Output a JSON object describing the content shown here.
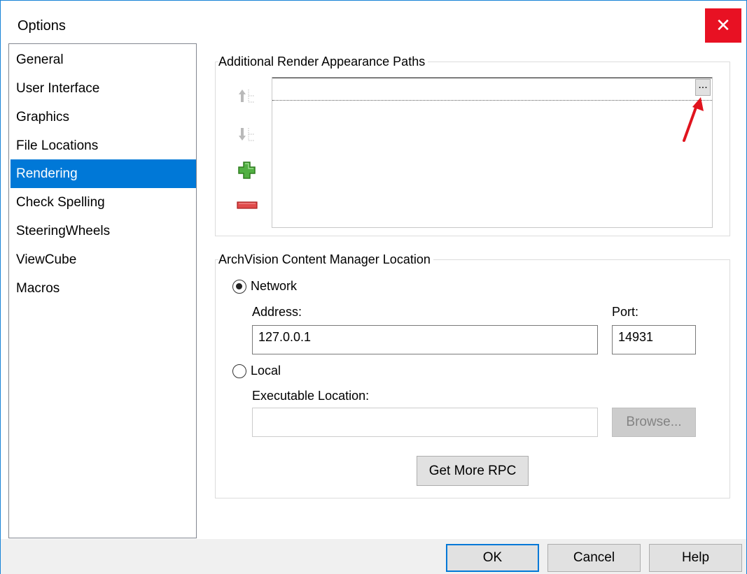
{
  "window": {
    "title": "Options",
    "close_label": "✕"
  },
  "nav": {
    "items": [
      {
        "label": "General"
      },
      {
        "label": "User Interface"
      },
      {
        "label": "Graphics"
      },
      {
        "label": "File Locations"
      },
      {
        "label": "Rendering",
        "selected": true
      },
      {
        "label": "Check Spelling"
      },
      {
        "label": "SteeringWheels"
      },
      {
        "label": "ViewCube"
      },
      {
        "label": "Macros"
      }
    ]
  },
  "render_paths": {
    "group_label": "Additional Render Appearance Paths",
    "browse_label": "...",
    "path_value": "",
    "tools": [
      "move-up-icon",
      "move-down-icon",
      "add-icon",
      "remove-icon"
    ]
  },
  "archvision": {
    "group_label": "ArchVision Content Manager Location",
    "network_label": "Network",
    "network_selected": true,
    "address_label": "Address:",
    "address_value": "127.0.0.1",
    "port_label": "Port:",
    "port_value": "14931",
    "local_label": "Local",
    "local_selected": false,
    "exe_label": "Executable Location:",
    "exe_value": "",
    "browse_label": "Browse...",
    "get_more_label": "Get More RPC"
  },
  "footer": {
    "ok_label": "OK",
    "cancel_label": "Cancel",
    "help_label": "Help"
  },
  "colors": {
    "accent": "#0078d7",
    "close": "#e81123",
    "annotation_arrow": "#e0141e"
  }
}
